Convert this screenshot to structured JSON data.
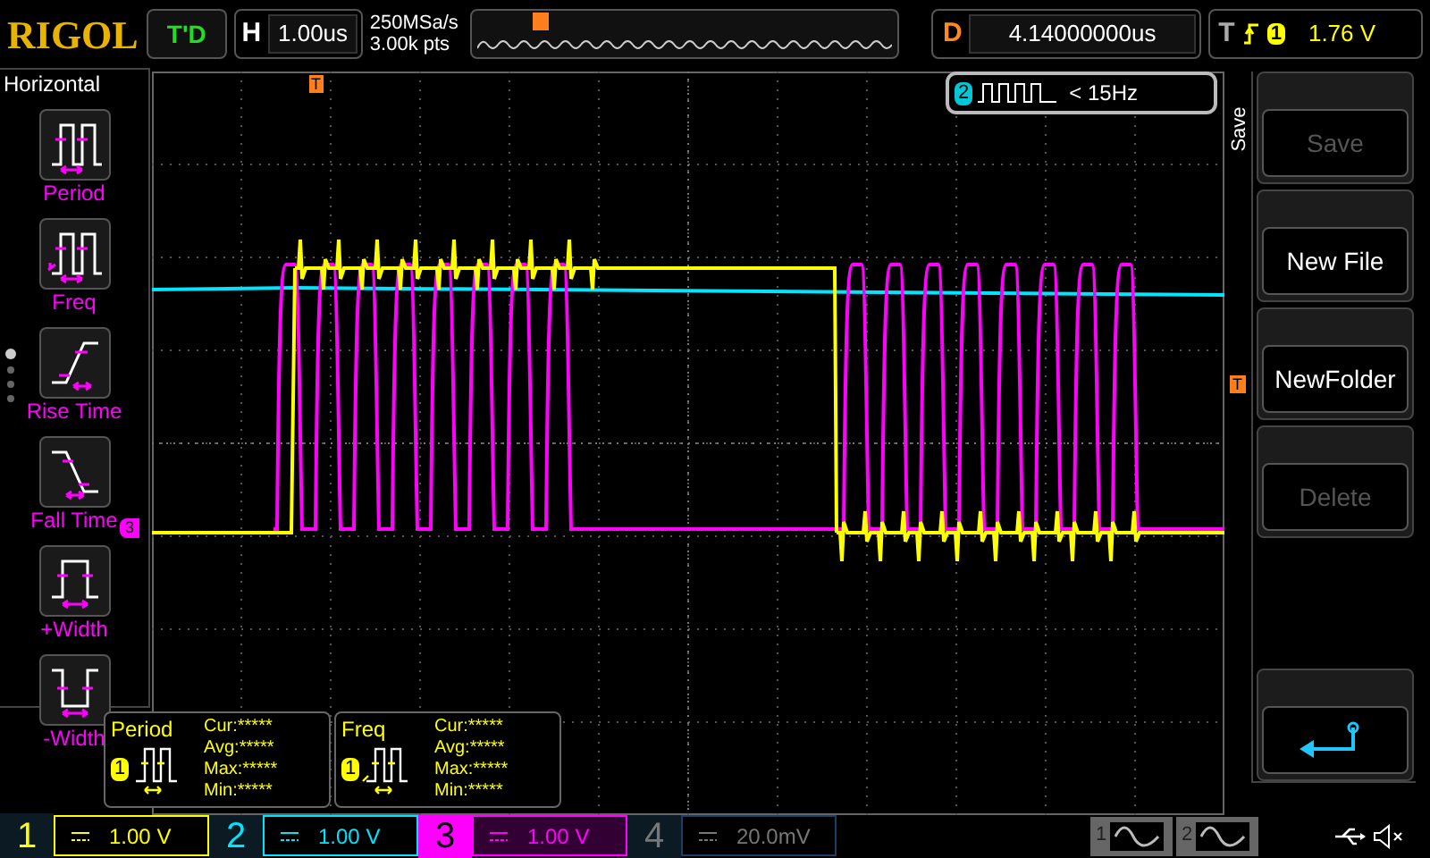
{
  "logo": "RIGOL",
  "run_status": "T'D",
  "timebase": {
    "label": "H",
    "value": "1.00us"
  },
  "sampling": {
    "rate": "250MSa/s",
    "depth": "3.00k pts"
  },
  "delay": {
    "label": "D",
    "value": "4.14000000us"
  },
  "trigger": {
    "label": "T",
    "source": "1",
    "level": "1.76 V"
  },
  "left_menu": {
    "title": "Horizontal",
    "items": [
      {
        "label": "Period",
        "kind": "period"
      },
      {
        "label": "Freq",
        "kind": "freq"
      },
      {
        "label": "Rise Time",
        "kind": "rise"
      },
      {
        "label": "Fall Time",
        "kind": "fall"
      },
      {
        "label": "+Width",
        "kind": "pwidth"
      },
      {
        "label": "-Width",
        "kind": "nwidth"
      }
    ],
    "pages": [
      {
        "selected": true
      },
      {
        "selected": false
      },
      {
        "selected": false
      },
      {
        "selected": false
      }
    ]
  },
  "screen": {
    "trigger_position_marker": "T",
    "trigger_level_marker": "T",
    "channel_marker": "3",
    "counter": {
      "channel": "2",
      "reading": "< 15Hz"
    }
  },
  "measurements": [
    {
      "name": "Period",
      "kind": "period",
      "channel": "1",
      "rows": [
        "Cur:*****",
        "Avg:*****",
        "Max:*****",
        "Min:*****"
      ]
    },
    {
      "name": "Freq",
      "kind": "freq",
      "channel": "1",
      "rows": [
        "Cur:*****",
        "Avg:*****",
        "Max:*****",
        "Min:*****"
      ]
    }
  ],
  "right_menu": {
    "title": "Save",
    "items": [
      {
        "kind": "text",
        "label": "Save",
        "disabled": true
      },
      {
        "kind": "text",
        "label": "New File",
        "disabled": false
      },
      {
        "kind": "text",
        "label": "NewFolder",
        "disabled": false
      },
      {
        "kind": "text",
        "label": "Delete",
        "disabled": true
      },
      {
        "kind": "spacer"
      },
      {
        "kind": "back"
      }
    ]
  },
  "channels": [
    {
      "number": "1",
      "value": "1.00 V",
      "color": "#ffff00",
      "enabled": true,
      "selected": false
    },
    {
      "number": "2",
      "value": "1.00 V",
      "color": "#00e5ff",
      "enabled": true,
      "selected": false
    },
    {
      "number": "3",
      "value": "1.00 V",
      "color": "#ff00ff",
      "enabled": true,
      "selected": true
    },
    {
      "number": "4",
      "value": "20.0mV",
      "color": "#1c3d66",
      "enabled": false,
      "selected": false
    }
  ],
  "math": [
    {
      "number": "1"
    },
    {
      "number": "2"
    }
  ]
}
